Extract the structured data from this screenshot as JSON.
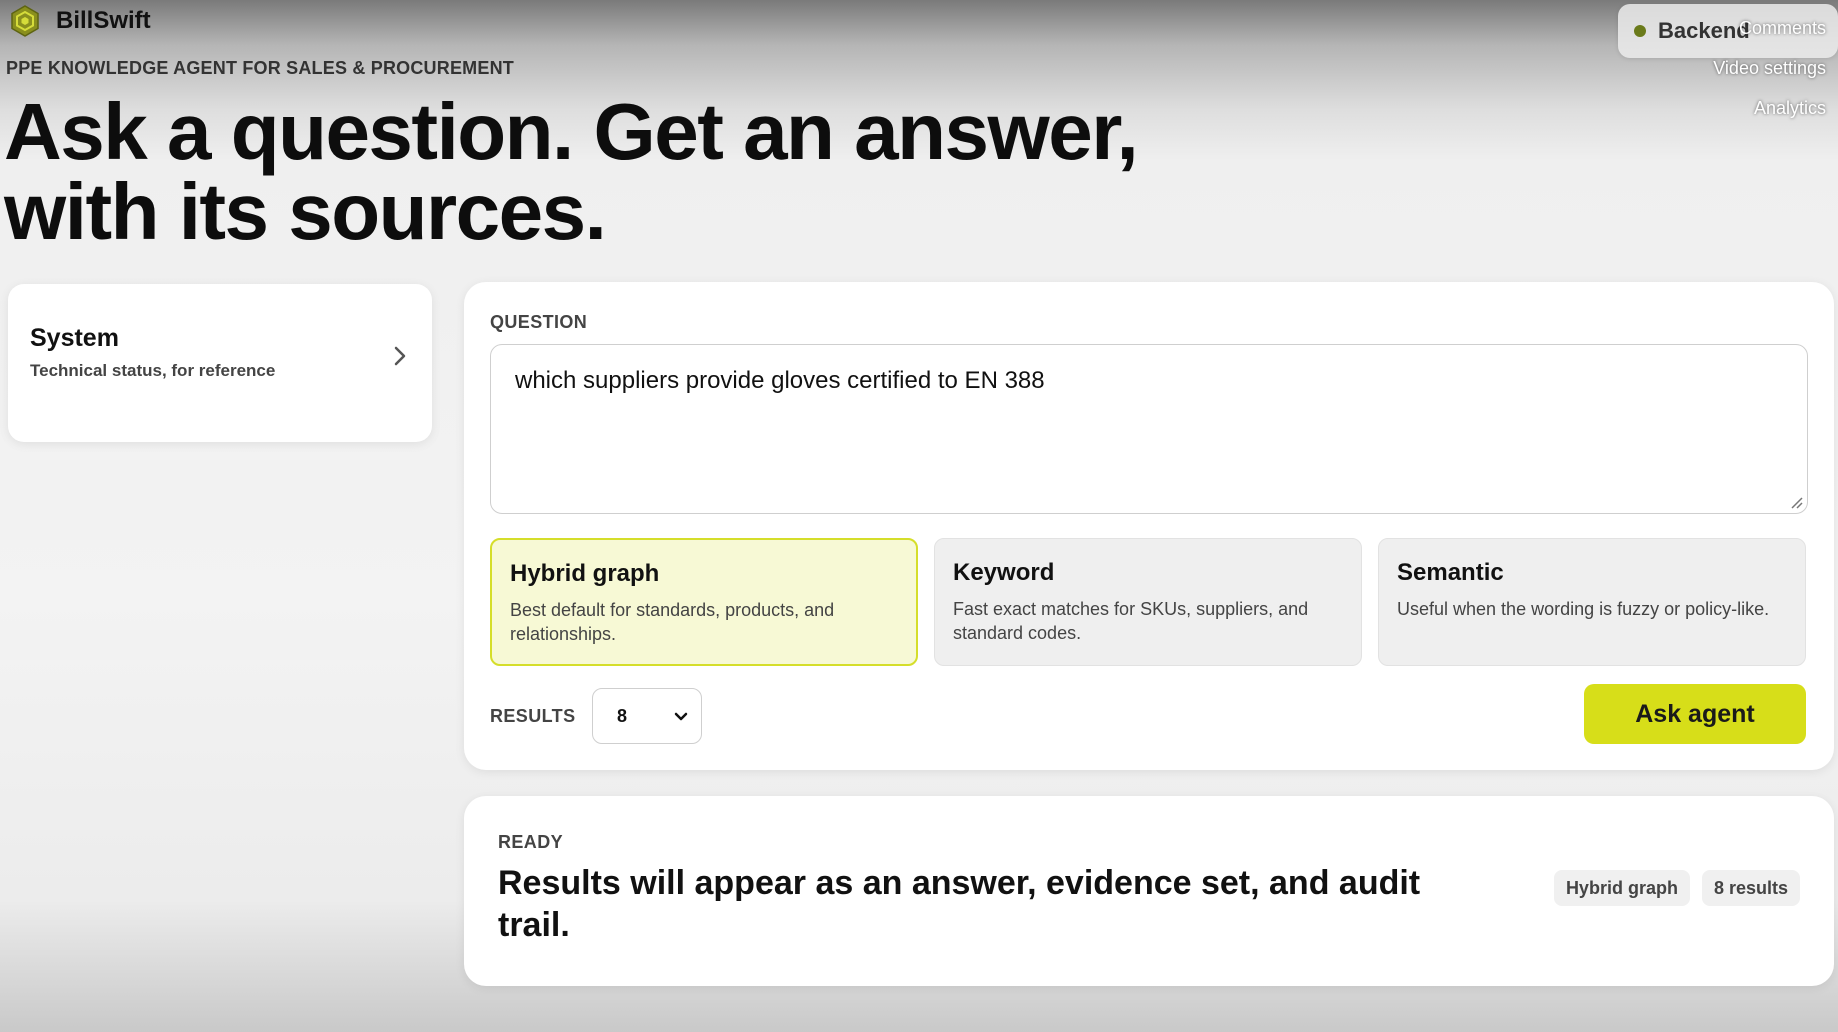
{
  "brand": {
    "name": "BillSwift",
    "logo_icon": "hexagon-logo-icon"
  },
  "header": {
    "eyebrow": "PPE KNOWLEDGE AGENT FOR SALES & PROCUREMENT",
    "headline_line1": "Ask a question. Get an answer,",
    "headline_line2": "with its sources."
  },
  "backend_status": {
    "label": "Backend",
    "status_color": "#6a7a1a"
  },
  "overlay_menu": [
    "Comments",
    "Video settings",
    "Analytics"
  ],
  "system_card": {
    "title": "System",
    "subtitle": "Technical status, for reference",
    "icon": "chevron-right-icon"
  },
  "question": {
    "label": "QUESTION",
    "value": "which suppliers provide gloves certified to EN 388"
  },
  "modes": [
    {
      "title": "Hybrid graph",
      "description": "Best default for standards, products, and relationships.",
      "selected": true
    },
    {
      "title": "Keyword",
      "description": "Fast exact matches for SKUs, suppliers, and standard codes.",
      "selected": false
    },
    {
      "title": "Semantic",
      "description": "Useful when the wording is fuzzy or policy-like.",
      "selected": false
    }
  ],
  "results_control": {
    "label": "RESULTS",
    "value": "8"
  },
  "ask_button": {
    "label": "Ask agent",
    "color": "#d7de19"
  },
  "results_panel": {
    "status": "READY",
    "message": "Results will appear as an answer, evidence set, and audit trail.",
    "chips": [
      "Hybrid graph",
      "8 results"
    ]
  }
}
